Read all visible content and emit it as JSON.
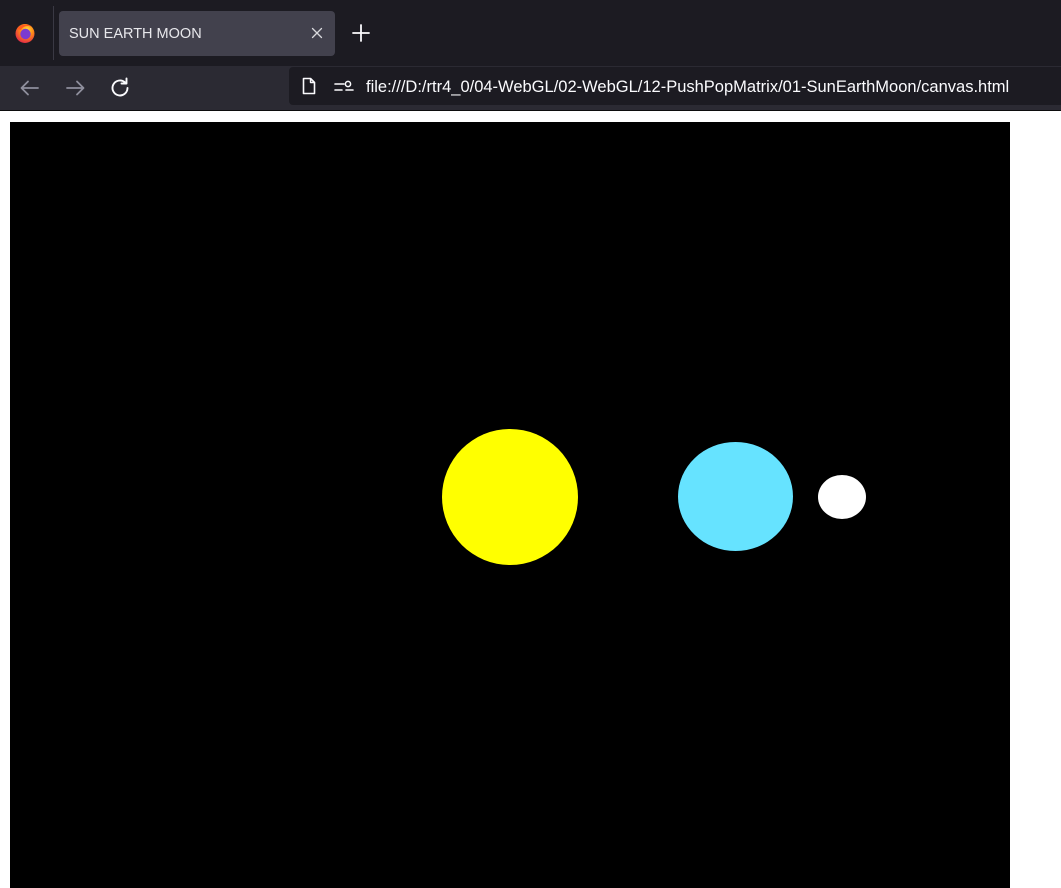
{
  "tab": {
    "title": "SUN EARTH MOON"
  },
  "urlbar": {
    "url": "file:///D:/rtr4_0/04-WebGL/02-WebGL/12-PushPopMatrix/01-SunEarthMoon/canvas.html"
  },
  "icons": {
    "browser_logo": "firefox-logo-icon",
    "tab_close": "close-icon",
    "new_tab": "plus-icon",
    "back": "back-arrow-icon",
    "forward": "forward-arrow-icon",
    "reload": "reload-icon",
    "page": "page-icon",
    "permissions": "permissions-icon"
  },
  "scene": {
    "background_color": "#000000",
    "bodies": [
      {
        "name": "sun",
        "color": "#ffff00"
      },
      {
        "name": "earth",
        "color": "#66e3ff"
      },
      {
        "name": "moon",
        "color": "#ffffff"
      }
    ]
  }
}
